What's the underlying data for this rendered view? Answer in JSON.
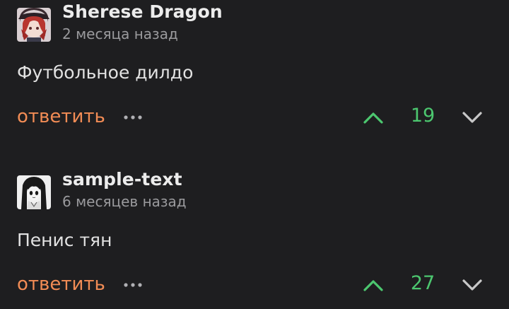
{
  "colors": {
    "background": "#1e1e20",
    "reply": "#f28c55",
    "score": "#4cc76f",
    "upvote": "#4cc76f",
    "downvote": "#c8c8c8",
    "meta": "#9a9a9d"
  },
  "comments": [
    {
      "author": "Sherese Dragon",
      "time": "2 месяца назад",
      "text": "Футбольное дилдо",
      "reply_label": "ответить",
      "score": "19",
      "avatar_icon": "anime-avatar-red-hair"
    },
    {
      "author": "sample-text",
      "time": "6 месяцев назад",
      "text": "Пенис тян",
      "reply_label": "ответить",
      "score": "27",
      "avatar_icon": "anime-avatar-monochrome"
    }
  ]
}
